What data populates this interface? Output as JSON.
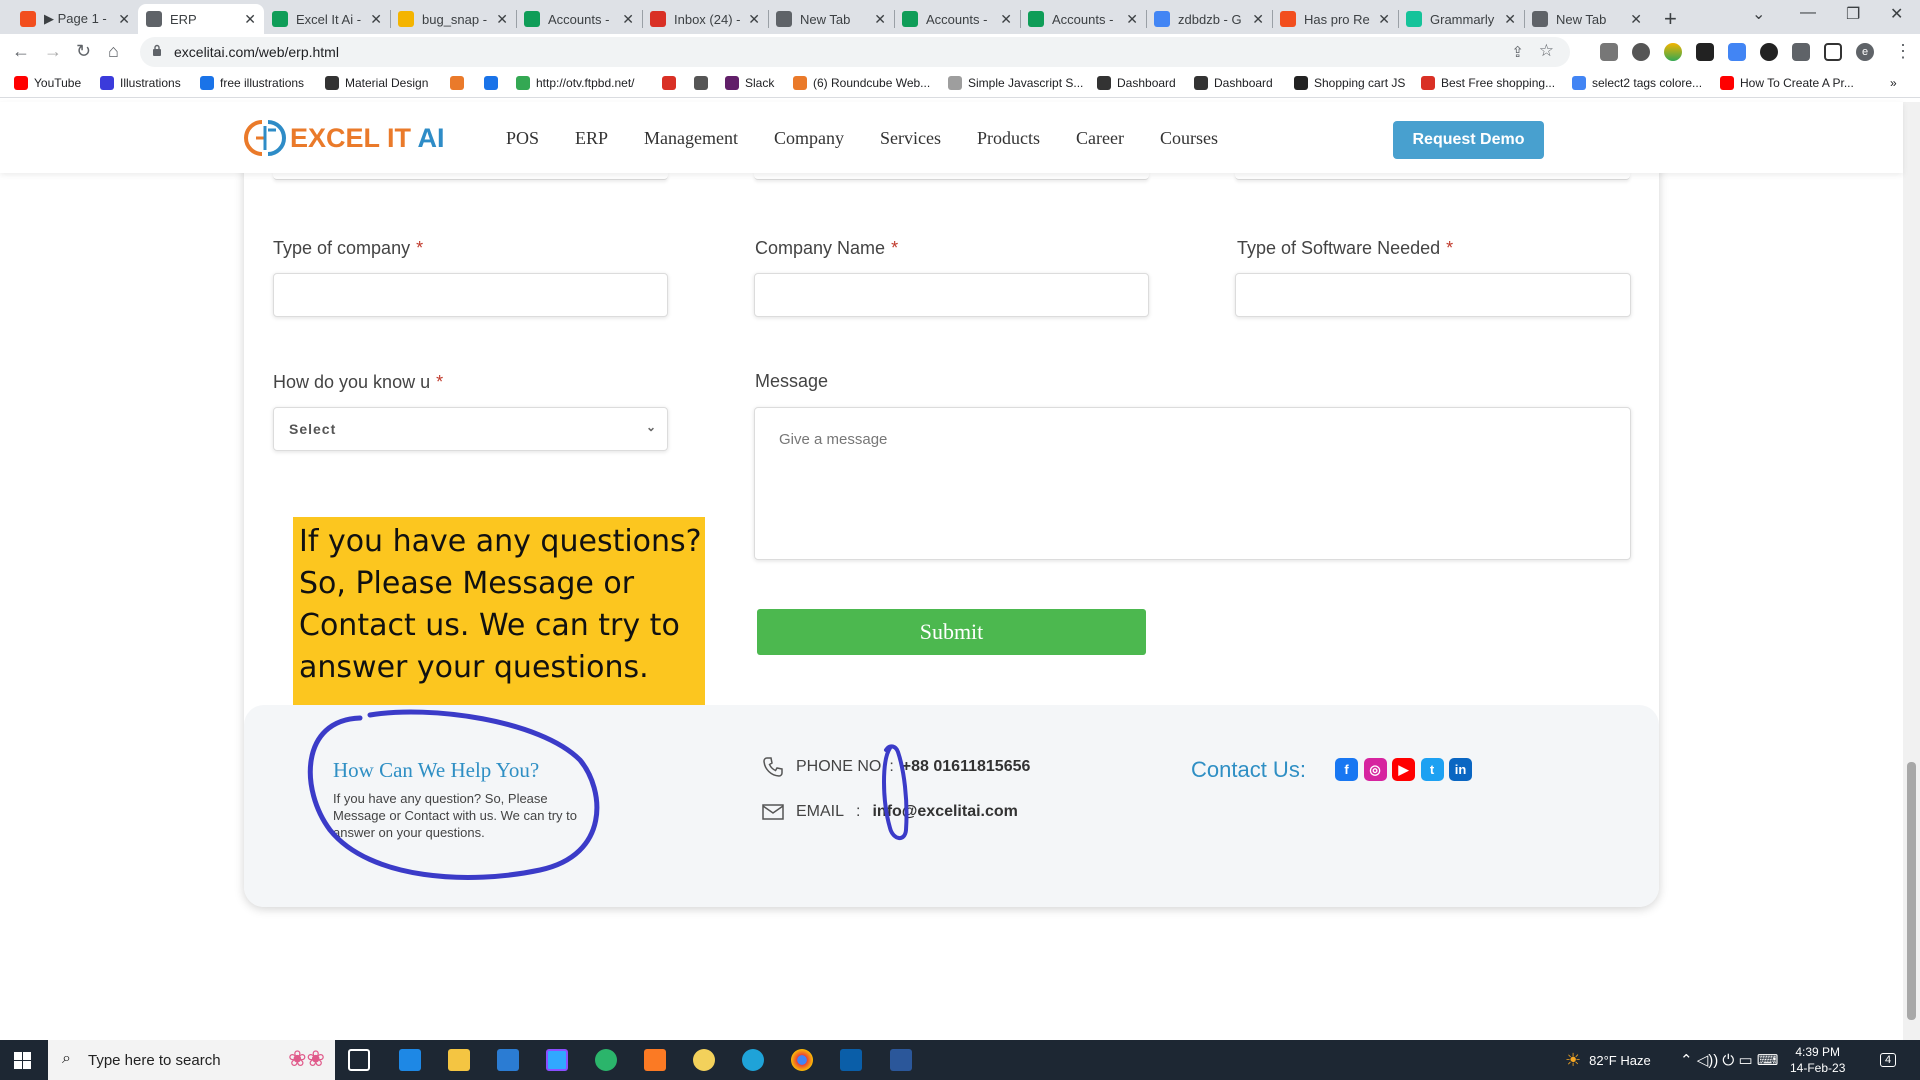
{
  "browser": {
    "tabs": [
      {
        "title": "▶ Page 1 -",
        "icon": "figma-icon",
        "color": "#f24e1e",
        "active": false
      },
      {
        "title": "ERP",
        "icon": "globe-icon",
        "color": "#5f6368",
        "active": true
      },
      {
        "title": "Excel It Ai -",
        "icon": "sheets-icon",
        "color": "#0f9d58",
        "active": false
      },
      {
        "title": "bug_snap -",
        "icon": "drive-icon",
        "color": "#f4b400",
        "active": false
      },
      {
        "title": "Accounts -",
        "icon": "sheets-icon",
        "color": "#0f9d58",
        "active": false
      },
      {
        "title": "Inbox (24) -",
        "icon": "gmail-icon",
        "color": "#d93025",
        "active": false
      },
      {
        "title": "New Tab",
        "icon": "globe-icon",
        "color": "#5f6368",
        "active": false
      },
      {
        "title": "Accounts -",
        "icon": "sheets-icon",
        "color": "#0f9d58",
        "active": false
      },
      {
        "title": "Accounts -",
        "icon": "sheets-icon",
        "color": "#0f9d58",
        "active": false
      },
      {
        "title": "zdbdzb - G",
        "icon": "google-icon",
        "color": "#4285f4",
        "active": false
      },
      {
        "title": "Has pro Re",
        "icon": "figma-icon",
        "color": "#f24e1e",
        "active": false
      },
      {
        "title": "Grammarly",
        "icon": "grammarly-icon",
        "color": "#15c39a",
        "active": false
      },
      {
        "title": "New Tab",
        "icon": "globe-icon",
        "color": "#5f6368",
        "active": false
      }
    ],
    "url": "excelitai.com/web/erp.html",
    "bookmarks": [
      {
        "label": "YouTube",
        "color": "#ff0000"
      },
      {
        "label": "Illustrations",
        "color": "#3b3bdb"
      },
      {
        "label": "free illustrations",
        "color": "#1a73e8"
      },
      {
        "label": "Material Design",
        "color": "#333333"
      },
      {
        "label": "",
        "color": "#ea7a2a"
      },
      {
        "label": "",
        "color": "#1a73e8"
      },
      {
        "label": "http://otv.ftpbd.net/",
        "color": "#34a853"
      },
      {
        "label": "",
        "color": "#d93025"
      },
      {
        "label": "",
        "color": "#555555"
      },
      {
        "label": "Slack",
        "color": "#611f69"
      },
      {
        "label": "(6) Roundcube Web...",
        "color": "#ea7a2a"
      },
      {
        "label": "Simple Javascript S...",
        "color": "#9e9e9e"
      },
      {
        "label": "Dashboard",
        "color": "#333333"
      },
      {
        "label": "Dashboard",
        "color": "#333333"
      },
      {
        "label": "Shopping cart JS",
        "color": "#222222"
      },
      {
        "label": "Best Free shopping...",
        "color": "#d93025"
      },
      {
        "label": "select2 tags colore...",
        "color": "#4285f4"
      },
      {
        "label": "How To Create A Pr...",
        "color": "#ff0000"
      }
    ]
  },
  "site": {
    "logo_main": "EXCEL IT",
    "logo_ai": "AI",
    "menu": [
      "POS",
      "ERP",
      "Management",
      "Company",
      "Services",
      "Products",
      "Career",
      "Courses"
    ],
    "demo_button": "Request Demo"
  },
  "form": {
    "type_of_company_label": "Type of company",
    "company_name_label": "Company Name",
    "software_label": "Type of Software Needed",
    "how_know_label": "How do you know u",
    "message_label": "Message",
    "required_mark": "*",
    "select_value": "Select",
    "message_placeholder": "Give a message",
    "submit_label": "Submit"
  },
  "callout": {
    "text": "If you have any questions? So, Please Message or Contact us. We can try to answer your questions."
  },
  "contact": {
    "help_title": "How Can We Help You?",
    "help_text": "If you have any question? So, Please Message or Contact with us. We can try to answer on your questions.",
    "phone_label": "PHONE NO",
    "phone_sep": ":",
    "phone_value": "+88 01611815656",
    "email_label": "EMAIL",
    "email_sep": ":",
    "email_value": "info@excelitai.com",
    "contact_title": "Contact Us:",
    "social": [
      {
        "name": "facebook-icon",
        "color": "#1877f2",
        "glyph": "f"
      },
      {
        "name": "instagram-icon",
        "color": "#d6249f",
        "glyph": "◎"
      },
      {
        "name": "youtube-icon",
        "color": "#ff0000",
        "glyph": "▶"
      },
      {
        "name": "twitter-icon",
        "color": "#1da1f2",
        "glyph": "t"
      },
      {
        "name": "linkedin-icon",
        "color": "#0a66c2",
        "glyph": "in"
      }
    ]
  },
  "taskbar": {
    "search_placeholder": "Type here to search",
    "weather": "82°F  Haze",
    "time": "4:39 PM",
    "date": "14-Feb-23",
    "notifications": "4"
  }
}
